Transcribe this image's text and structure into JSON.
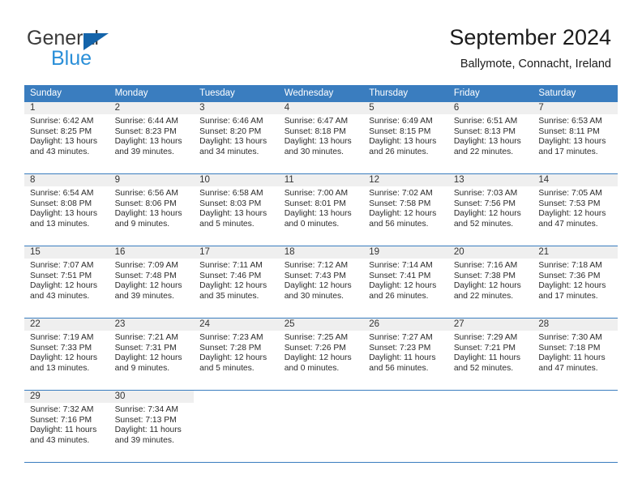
{
  "brand": {
    "name_part1": "General",
    "name_part2": "Blue",
    "accent_color": "#1464aa",
    "blue_text_color": "#2a8fd8"
  },
  "header": {
    "title": "September 2024",
    "location": "Ballymote, Connacht, Ireland"
  },
  "theme": {
    "header_row_bg": "#3a7dbf",
    "day_number_bg": "#efefef",
    "text_color": "#2b2b2b"
  },
  "weekdays": [
    "Sunday",
    "Monday",
    "Tuesday",
    "Wednesday",
    "Thursday",
    "Friday",
    "Saturday"
  ],
  "labels": {
    "sunrise_prefix": "Sunrise:",
    "sunset_prefix": "Sunset:",
    "daylight_prefix": "Daylight:"
  },
  "weeks": [
    [
      {
        "day": "1",
        "sunrise": "Sunrise: 6:42 AM",
        "sunset": "Sunset: 8:25 PM",
        "daylight_line1": "Daylight: 13 hours",
        "daylight_line2": "and 43 minutes."
      },
      {
        "day": "2",
        "sunrise": "Sunrise: 6:44 AM",
        "sunset": "Sunset: 8:23 PM",
        "daylight_line1": "Daylight: 13 hours",
        "daylight_line2": "and 39 minutes."
      },
      {
        "day": "3",
        "sunrise": "Sunrise: 6:46 AM",
        "sunset": "Sunset: 8:20 PM",
        "daylight_line1": "Daylight: 13 hours",
        "daylight_line2": "and 34 minutes."
      },
      {
        "day": "4",
        "sunrise": "Sunrise: 6:47 AM",
        "sunset": "Sunset: 8:18 PM",
        "daylight_line1": "Daylight: 13 hours",
        "daylight_line2": "and 30 minutes."
      },
      {
        "day": "5",
        "sunrise": "Sunrise: 6:49 AM",
        "sunset": "Sunset: 8:15 PM",
        "daylight_line1": "Daylight: 13 hours",
        "daylight_line2": "and 26 minutes."
      },
      {
        "day": "6",
        "sunrise": "Sunrise: 6:51 AM",
        "sunset": "Sunset: 8:13 PM",
        "daylight_line1": "Daylight: 13 hours",
        "daylight_line2": "and 22 minutes."
      },
      {
        "day": "7",
        "sunrise": "Sunrise: 6:53 AM",
        "sunset": "Sunset: 8:11 PM",
        "daylight_line1": "Daylight: 13 hours",
        "daylight_line2": "and 17 minutes."
      }
    ],
    [
      {
        "day": "8",
        "sunrise": "Sunrise: 6:54 AM",
        "sunset": "Sunset: 8:08 PM",
        "daylight_line1": "Daylight: 13 hours",
        "daylight_line2": "and 13 minutes."
      },
      {
        "day": "9",
        "sunrise": "Sunrise: 6:56 AM",
        "sunset": "Sunset: 8:06 PM",
        "daylight_line1": "Daylight: 13 hours",
        "daylight_line2": "and 9 minutes."
      },
      {
        "day": "10",
        "sunrise": "Sunrise: 6:58 AM",
        "sunset": "Sunset: 8:03 PM",
        "daylight_line1": "Daylight: 13 hours",
        "daylight_line2": "and 5 minutes."
      },
      {
        "day": "11",
        "sunrise": "Sunrise: 7:00 AM",
        "sunset": "Sunset: 8:01 PM",
        "daylight_line1": "Daylight: 13 hours",
        "daylight_line2": "and 0 minutes."
      },
      {
        "day": "12",
        "sunrise": "Sunrise: 7:02 AM",
        "sunset": "Sunset: 7:58 PM",
        "daylight_line1": "Daylight: 12 hours",
        "daylight_line2": "and 56 minutes."
      },
      {
        "day": "13",
        "sunrise": "Sunrise: 7:03 AM",
        "sunset": "Sunset: 7:56 PM",
        "daylight_line1": "Daylight: 12 hours",
        "daylight_line2": "and 52 minutes."
      },
      {
        "day": "14",
        "sunrise": "Sunrise: 7:05 AM",
        "sunset": "Sunset: 7:53 PM",
        "daylight_line1": "Daylight: 12 hours",
        "daylight_line2": "and 47 minutes."
      }
    ],
    [
      {
        "day": "15",
        "sunrise": "Sunrise: 7:07 AM",
        "sunset": "Sunset: 7:51 PM",
        "daylight_line1": "Daylight: 12 hours",
        "daylight_line2": "and 43 minutes."
      },
      {
        "day": "16",
        "sunrise": "Sunrise: 7:09 AM",
        "sunset": "Sunset: 7:48 PM",
        "daylight_line1": "Daylight: 12 hours",
        "daylight_line2": "and 39 minutes."
      },
      {
        "day": "17",
        "sunrise": "Sunrise: 7:11 AM",
        "sunset": "Sunset: 7:46 PM",
        "daylight_line1": "Daylight: 12 hours",
        "daylight_line2": "and 35 minutes."
      },
      {
        "day": "18",
        "sunrise": "Sunrise: 7:12 AM",
        "sunset": "Sunset: 7:43 PM",
        "daylight_line1": "Daylight: 12 hours",
        "daylight_line2": "and 30 minutes."
      },
      {
        "day": "19",
        "sunrise": "Sunrise: 7:14 AM",
        "sunset": "Sunset: 7:41 PM",
        "daylight_line1": "Daylight: 12 hours",
        "daylight_line2": "and 26 minutes."
      },
      {
        "day": "20",
        "sunrise": "Sunrise: 7:16 AM",
        "sunset": "Sunset: 7:38 PM",
        "daylight_line1": "Daylight: 12 hours",
        "daylight_line2": "and 22 minutes."
      },
      {
        "day": "21",
        "sunrise": "Sunrise: 7:18 AM",
        "sunset": "Sunset: 7:36 PM",
        "daylight_line1": "Daylight: 12 hours",
        "daylight_line2": "and 17 minutes."
      }
    ],
    [
      {
        "day": "22",
        "sunrise": "Sunrise: 7:19 AM",
        "sunset": "Sunset: 7:33 PM",
        "daylight_line1": "Daylight: 12 hours",
        "daylight_line2": "and 13 minutes."
      },
      {
        "day": "23",
        "sunrise": "Sunrise: 7:21 AM",
        "sunset": "Sunset: 7:31 PM",
        "daylight_line1": "Daylight: 12 hours",
        "daylight_line2": "and 9 minutes."
      },
      {
        "day": "24",
        "sunrise": "Sunrise: 7:23 AM",
        "sunset": "Sunset: 7:28 PM",
        "daylight_line1": "Daylight: 12 hours",
        "daylight_line2": "and 5 minutes."
      },
      {
        "day": "25",
        "sunrise": "Sunrise: 7:25 AM",
        "sunset": "Sunset: 7:26 PM",
        "daylight_line1": "Daylight: 12 hours",
        "daylight_line2": "and 0 minutes."
      },
      {
        "day": "26",
        "sunrise": "Sunrise: 7:27 AM",
        "sunset": "Sunset: 7:23 PM",
        "daylight_line1": "Daylight: 11 hours",
        "daylight_line2": "and 56 minutes."
      },
      {
        "day": "27",
        "sunrise": "Sunrise: 7:29 AM",
        "sunset": "Sunset: 7:21 PM",
        "daylight_line1": "Daylight: 11 hours",
        "daylight_line2": "and 52 minutes."
      },
      {
        "day": "28",
        "sunrise": "Sunrise: 7:30 AM",
        "sunset": "Sunset: 7:18 PM",
        "daylight_line1": "Daylight: 11 hours",
        "daylight_line2": "and 47 minutes."
      }
    ],
    [
      {
        "day": "29",
        "sunrise": "Sunrise: 7:32 AM",
        "sunset": "Sunset: 7:16 PM",
        "daylight_line1": "Daylight: 11 hours",
        "daylight_line2": "and 43 minutes."
      },
      {
        "day": "30",
        "sunrise": "Sunrise: 7:34 AM",
        "sunset": "Sunset: 7:13 PM",
        "daylight_line1": "Daylight: 11 hours",
        "daylight_line2": "and 39 minutes."
      },
      {
        "day": "",
        "sunrise": "",
        "sunset": "",
        "daylight_line1": "",
        "daylight_line2": ""
      },
      {
        "day": "",
        "sunrise": "",
        "sunset": "",
        "daylight_line1": "",
        "daylight_line2": ""
      },
      {
        "day": "",
        "sunrise": "",
        "sunset": "",
        "daylight_line1": "",
        "daylight_line2": ""
      },
      {
        "day": "",
        "sunrise": "",
        "sunset": "",
        "daylight_line1": "",
        "daylight_line2": ""
      },
      {
        "day": "",
        "sunrise": "",
        "sunset": "",
        "daylight_line1": "",
        "daylight_line2": ""
      }
    ]
  ]
}
